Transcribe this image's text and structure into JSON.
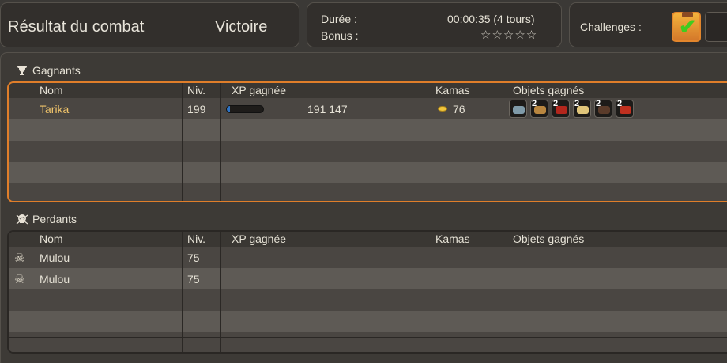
{
  "header": {
    "title": "Résultat du combat",
    "result": "Victoire",
    "duration_label": "Durée :",
    "duration_value": "00:00:35 (4 tours)",
    "bonus_label": "Bonus :",
    "bonus_stars": "☆☆☆☆☆",
    "challenges_label": "Challenges :"
  },
  "columns": {
    "name": "Nom",
    "level": "Niv.",
    "xp": "XP gagnée",
    "kamas": "Kamas",
    "items": "Objets gagnés"
  },
  "winners": {
    "title": "Gagnants",
    "rows": [
      {
        "name": "Tarika",
        "level": "199",
        "xp": "191 147",
        "xp_bar_fraction": 0.08,
        "kamas": "76",
        "items": [
          {
            "icon": "stone-item-icon",
            "qty": "",
            "color": "#7f9aa8"
          },
          {
            "icon": "creature-item-icon",
            "qty": "2",
            "color": "#b9863f"
          },
          {
            "icon": "red-leather-item-icon",
            "qty": "2",
            "color": "#b3261c"
          },
          {
            "icon": "claw-item-icon",
            "qty": "2",
            "color": "#e0c57a"
          },
          {
            "icon": "dark-leather-item-icon",
            "qty": "2",
            "color": "#5a3b2a"
          },
          {
            "icon": "red-leather-item-icon",
            "qty": "2",
            "color": "#c0301f"
          }
        ]
      }
    ]
  },
  "losers": {
    "title": "Perdants",
    "rows": [
      {
        "name": "Mulou",
        "level": "75"
      },
      {
        "name": "Mulou",
        "level": "75"
      }
    ]
  },
  "colors": {
    "accent_border": "#e07e2a",
    "winner_name": "#f0c46a",
    "xp_bar": "#2e74c6",
    "challenge_check": "#3fcc1f"
  }
}
